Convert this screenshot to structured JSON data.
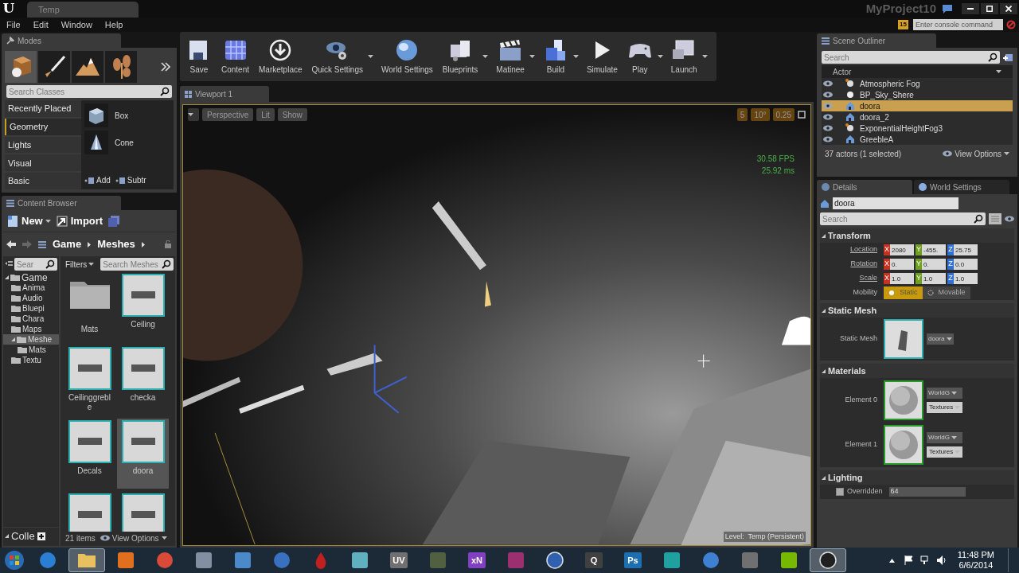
{
  "title_bar": {
    "logo": "U",
    "tab": "Temp",
    "project": "MyProject10"
  },
  "menu": [
    "File",
    "Edit",
    "Window",
    "Help"
  ],
  "console": {
    "badge": "15",
    "placeholder": "Enter console command"
  },
  "modes": {
    "title": "Modes",
    "tools": [
      {
        "kind": "place",
        "selected": true
      },
      {
        "kind": "paint",
        "selected": false
      },
      {
        "kind": "landscape",
        "selected": false
      },
      {
        "kind": "foliage",
        "selected": false
      }
    ],
    "search_placeholder": "Search Classes",
    "categories": [
      {
        "label": "Recently Placed",
        "selected": false
      },
      {
        "label": "Geometry",
        "selected": true
      },
      {
        "label": "Lights",
        "selected": false
      },
      {
        "label": "Visual",
        "selected": false
      },
      {
        "label": "Basic",
        "selected": false
      }
    ],
    "items": [
      {
        "label": "Box",
        "kind": "box"
      },
      {
        "label": "Cone",
        "kind": "cone"
      }
    ],
    "add": "Add",
    "subtract": "Subtr"
  },
  "content_browser": {
    "title": "Content Browser",
    "new": "New",
    "import": "Import",
    "path": [
      "Game",
      "Meshes"
    ],
    "tree_search": {
      "placeholder": "Sear"
    },
    "tree": [
      {
        "label": "Game",
        "selected": false,
        "children": [
          {
            "label": "Anima",
            "selected": false
          },
          {
            "label": "Audio",
            "selected": false
          },
          {
            "label": "Bluepi",
            "selected": false
          },
          {
            "label": "Chara",
            "selected": false
          },
          {
            "label": "Maps",
            "selected": false
          },
          {
            "label": "Meshe",
            "selected": true,
            "children": [
              {
                "label": "Mats",
                "selected": false
              }
            ]
          },
          {
            "label": "Textu",
            "selected": false
          }
        ]
      }
    ],
    "filters": "Filters",
    "search_placeholder": "Search Meshes",
    "assets": [
      {
        "label": "Mats",
        "kind": "folder",
        "selected": false
      },
      {
        "label": "Ceiling",
        "kind": "mesh",
        "selected": false
      },
      {
        "label": "Ceilinggreble",
        "kind": "mesh",
        "selected": false
      },
      {
        "label": "checka",
        "kind": "mesh",
        "selected": false
      },
      {
        "label": "Decals",
        "kind": "mesh",
        "selected": false
      },
      {
        "label": "doora",
        "kind": "mesh",
        "selected": true
      },
      {
        "kind": "mesh",
        "selected": false
      },
      {
        "kind": "mesh",
        "selected": false
      }
    ],
    "collections": "Colle",
    "count": "21 items",
    "view_options": "View Options"
  },
  "toolbar": [
    {
      "label": "Save",
      "kind": "save",
      "menu": false
    },
    {
      "label": "Content",
      "kind": "content",
      "menu": false
    },
    {
      "label": "Marketplace",
      "kind": "marketplace",
      "menu": false
    },
    {
      "label": "Quick Settings",
      "kind": "settings",
      "menu": true
    },
    {
      "label": "World Settings",
      "kind": "world",
      "menu": false
    },
    {
      "label": "Blueprints",
      "kind": "blueprints",
      "menu": true
    },
    {
      "label": "Matinee",
      "kind": "matinee",
      "menu": true
    },
    {
      "label": "Build",
      "kind": "build",
      "menu": true
    },
    {
      "label": "Simulate",
      "kind": "simulate",
      "menu": false
    },
    {
      "label": "Play",
      "kind": "play",
      "menu": true
    },
    {
      "label": "Launch",
      "kind": "launch",
      "menu": true
    }
  ],
  "viewport": {
    "tab": "Viewport 1",
    "buttons": [
      "Perspective",
      "Lit",
      "Show"
    ],
    "snaps": [
      "5",
      "10°",
      "0.25"
    ],
    "fps": "30.58 FPS",
    "ms": "25.92 ms",
    "level": "Level:  Temp (Persistent)"
  },
  "outliner": {
    "title": "Scene Outliner",
    "search_placeholder": "Search",
    "column": "Actor",
    "rows": [
      {
        "label": "Atmospheric Fog",
        "kind": "light",
        "selected": false
      },
      {
        "label": "BP_Sky_Shere",
        "kind": "sphere",
        "selected": false
      },
      {
        "label": "doora",
        "kind": "mesh",
        "selected": true
      },
      {
        "label": "doora_2",
        "kind": "mesh",
        "selected": false
      },
      {
        "label": "ExponentialHeightFog3",
        "kind": "light",
        "selected": false
      },
      {
        "label": "GreebleA",
        "kind": "mesh",
        "selected": false
      }
    ],
    "count": "37 actors (1 selected)",
    "view_options": "View Options"
  },
  "details": {
    "tabs": [
      {
        "label": "Details",
        "selected": true
      },
      {
        "label": "World Settings",
        "selected": false
      }
    ],
    "name": "doora",
    "search_placeholder": "Search",
    "transform": {
      "title": "Transform",
      "rows": [
        {
          "label": "Location",
          "axes": [
            "X",
            "Y",
            "Z"
          ],
          "values": [
            "2080",
            "-455.",
            "25.75"
          ]
        },
        {
          "label": "Rotation",
          "axes": [
            "X",
            "Y",
            "Z"
          ],
          "values": [
            "0.",
            "0.",
            "0.0"
          ]
        },
        {
          "label": "Scale",
          "axes": [
            "X",
            "Y",
            "Z"
          ],
          "values": [
            "1.0",
            "1.0",
            "1.0"
          ]
        }
      ],
      "mobility": {
        "label": "Mobility",
        "options": [
          {
            "label": "Static",
            "selected": true
          },
          {
            "label": "Movable",
            "selected": false
          }
        ]
      }
    },
    "static_mesh": {
      "title": "Static Mesh",
      "label": "Static Mesh",
      "asset": "doora"
    },
    "materials": {
      "title": "Materials",
      "elements": [
        {
          "label": "Element 0",
          "material": "WorldG",
          "textures": "Textures"
        },
        {
          "label": "Element 1",
          "material": "WorldG",
          "textures": "Textures"
        }
      ]
    },
    "lighting": {
      "title": "Lighting",
      "label": "Overridden",
      "checked": false,
      "value": "64"
    }
  },
  "taskbar": {
    "apps": [
      {
        "kind": "ie",
        "color": "#2a7fd4",
        "selected": false
      },
      {
        "kind": "folder",
        "color": "#e8c060",
        "selected": true
      },
      {
        "kind": "media",
        "color": "#e07020",
        "selected": false
      },
      {
        "kind": "chrome",
        "color": "#d94a38",
        "selected": false
      },
      {
        "kind": "square",
        "color": "#8090a0",
        "selected": false
      },
      {
        "kind": "square",
        "color": "#4a8ac8",
        "selected": false
      },
      {
        "kind": "circle",
        "color": "#3a70c0",
        "selected": false
      },
      {
        "kind": "drop",
        "color": "#c02020",
        "selected": false
      },
      {
        "kind": "square",
        "color": "#60b0c0",
        "selected": false
      },
      {
        "kind": "text",
        "text": "UV",
        "color": "#707070",
        "selected": false
      },
      {
        "kind": "square",
        "color": "#506040",
        "selected": false
      },
      {
        "kind": "text",
        "text": "xN",
        "color": "#8040c0",
        "selected": false
      },
      {
        "kind": "square",
        "color": "#9a3070",
        "selected": false
      },
      {
        "kind": "ue",
        "color": "#3060b0",
        "selected": false
      },
      {
        "kind": "text",
        "text": "Q",
        "color": "#404040",
        "selected": false
      },
      {
        "kind": "text",
        "text": "Ps",
        "color": "#1e6fb0",
        "selected": false
      },
      {
        "kind": "square",
        "color": "#20a0a0",
        "selected": false
      },
      {
        "kind": "circle",
        "color": "#4080d0",
        "selected": false
      },
      {
        "kind": "square",
        "color": "#707070",
        "selected": false
      },
      {
        "kind": "square",
        "color": "#76b900",
        "selected": false
      },
      {
        "kind": "ue",
        "color": "#202020",
        "selected": true
      }
    ],
    "time": "11:48 PM",
    "date": "6/6/2014"
  }
}
